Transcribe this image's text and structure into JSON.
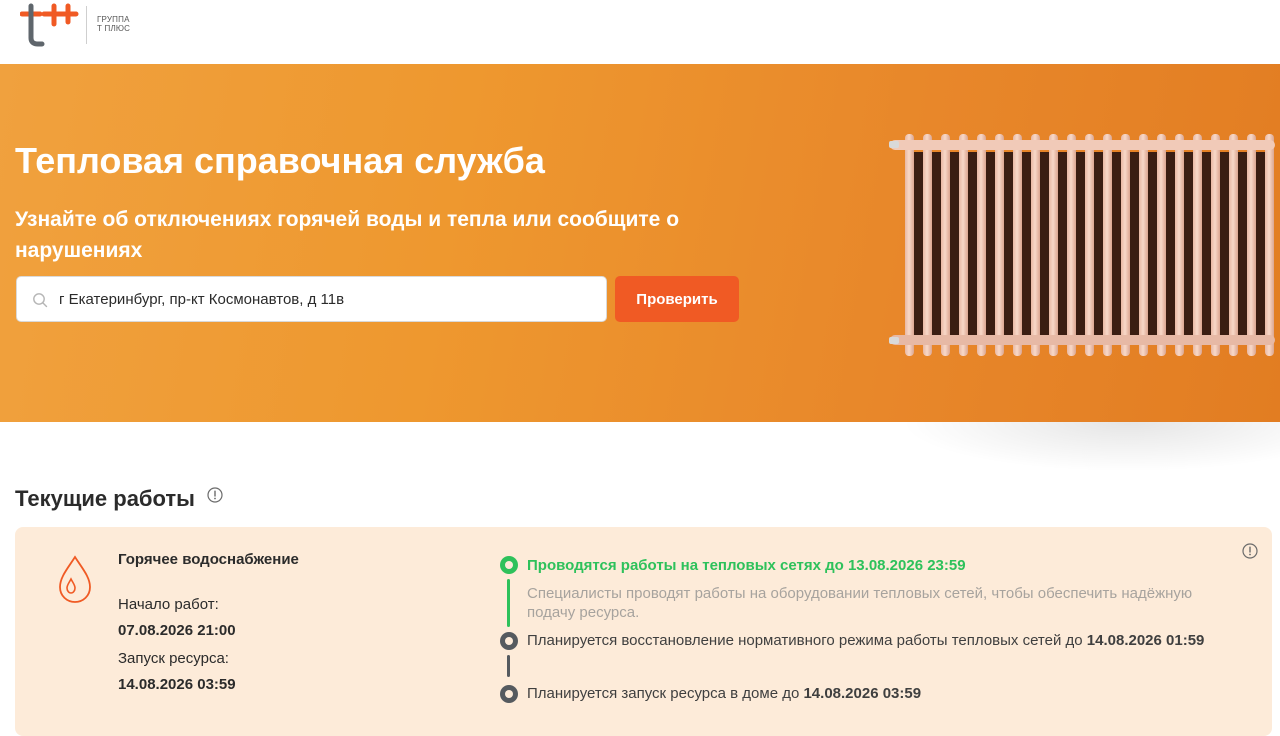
{
  "header": {
    "logo_line1": "ГРУППА",
    "logo_line2": "Т ПЛЮС"
  },
  "hero": {
    "title": "Тепловая справочная служба",
    "subtitle": "Узнайте об отключениях горячей воды и тепла или сообщите о нарушениях",
    "search_value": "г Екатеринбург, пр-кт Космонавтов, д 11в",
    "check_button": "Проверить"
  },
  "section": {
    "title": "Текущие работы"
  },
  "card": {
    "service_title": "Горячее водоснабжение",
    "start_label": "Начало работ:",
    "start_value": "07.08.2026 21:00",
    "launch_label": "Запуск ресурса:",
    "launch_value": "14.08.2026 03:59",
    "steps": [
      {
        "text": "Проводятся работы на тепловых сетях до ",
        "date": "13.08.2026 23:59",
        "status": "active",
        "description": "Специалисты проводят работы на оборудовании тепловых сетей, чтобы обеспечить надёжную подачу ресурса."
      },
      {
        "text": "Планируется восстановление нормативного режима работы тепловых сетей до ",
        "date": "14.08.2026 01:59",
        "status": "planned"
      },
      {
        "text": "Планируется запуск ресурса в доме до ",
        "date": "14.08.2026 03:59",
        "status": "planned"
      }
    ]
  },
  "colors": {
    "brand_orange": "#f05a24",
    "hero_orange": "#ee982f",
    "active_green": "#2ec15b",
    "card_bg": "#fdebd9"
  },
  "icons": {
    "search": "search-icon",
    "info": "info-icon",
    "drop": "water-drop-icon"
  }
}
